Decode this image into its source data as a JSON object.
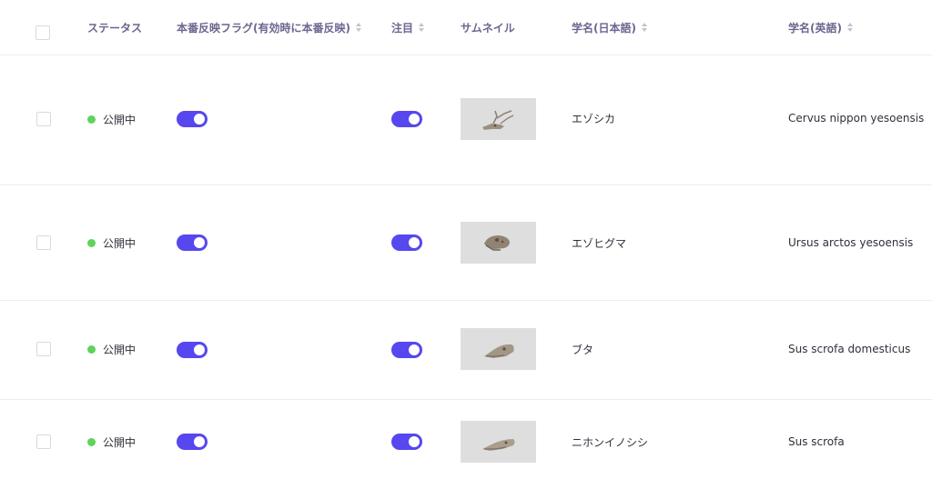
{
  "header": {
    "status": "ステータス",
    "reflect_flag": "本番反映フラグ(有効時に本番反映)",
    "featured": "注目",
    "thumbnail": "サムネイル",
    "jp_name": "学名(日本語)",
    "en_name": "学名(英語)"
  },
  "rows": [
    {
      "status": "公開中",
      "reflect_enabled": true,
      "featured": true,
      "thumbnail_icon": "deer-skull-icon",
      "jp_name": "エゾシカ",
      "en_name": "Cervus nippon yesoensis"
    },
    {
      "status": "公開中",
      "reflect_enabled": true,
      "featured": true,
      "thumbnail_icon": "bear-skull-icon",
      "jp_name": "エゾヒグマ",
      "en_name": "Ursus arctos yesoensis"
    },
    {
      "status": "公開中",
      "reflect_enabled": true,
      "featured": true,
      "thumbnail_icon": "pig-skull-icon",
      "jp_name": "ブタ",
      "en_name": "Sus scrofa domesticus"
    },
    {
      "status": "公開中",
      "reflect_enabled": true,
      "featured": true,
      "thumbnail_icon": "boar-skull-icon",
      "jp_name": "ニホンイノシシ",
      "en_name": "Sus scrofa"
    }
  ],
  "colors": {
    "accent": "#5647ef",
    "status_published": "#5fd35a",
    "thumbnail_bg": "#dedede"
  }
}
